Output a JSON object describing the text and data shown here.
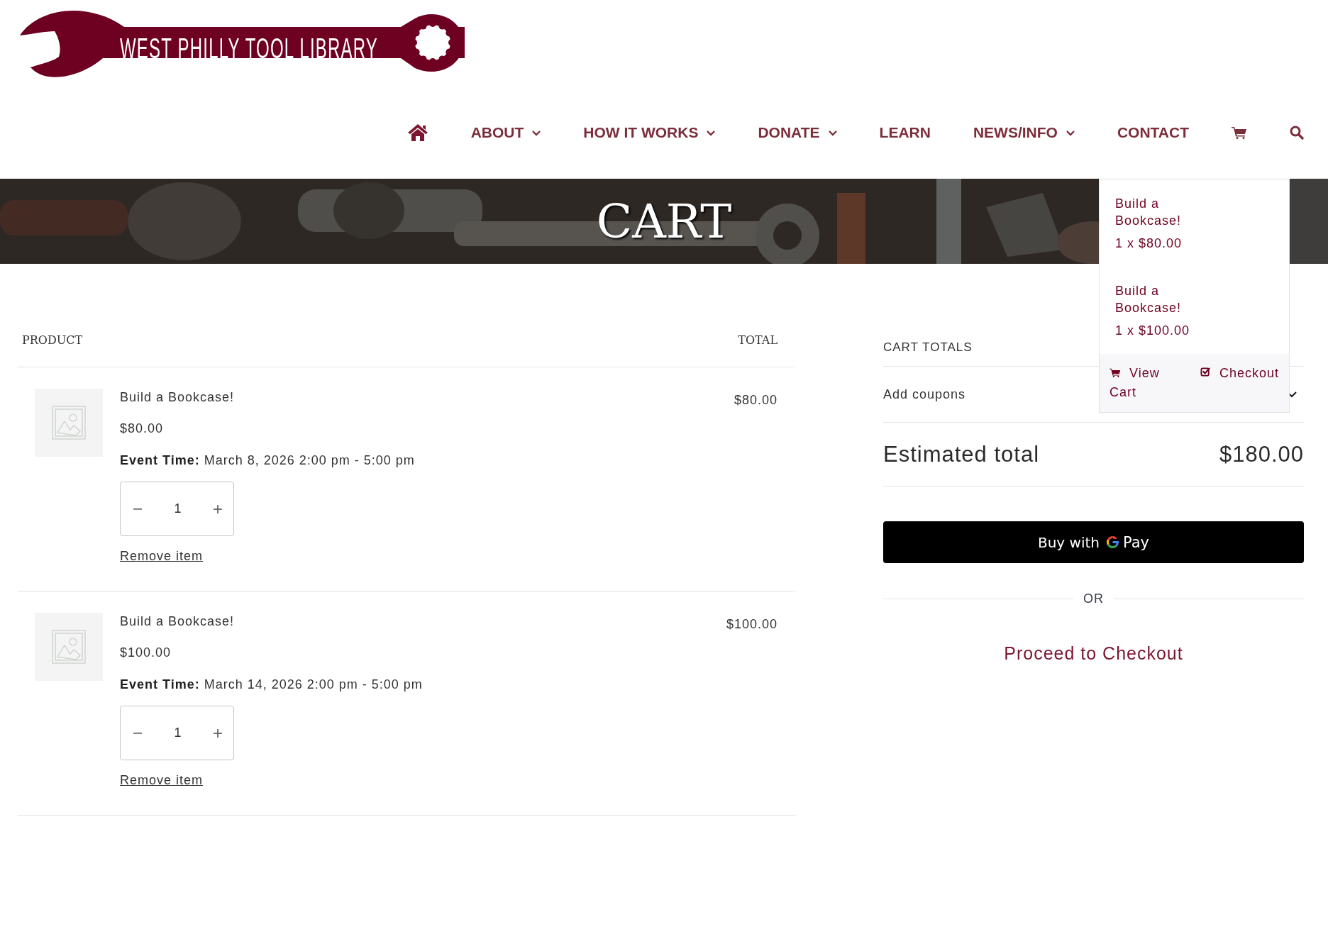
{
  "logo": {
    "text": "WEST PHILLY TOOL LIBRARY"
  },
  "nav": [
    {
      "label": "ABOUT",
      "has_menu": true
    },
    {
      "label": "HOW IT WORKS",
      "has_menu": true
    },
    {
      "label": "DONATE",
      "has_menu": true
    },
    {
      "label": "LEARN",
      "has_menu": false
    },
    {
      "label": "NEWS/INFO",
      "has_menu": true
    },
    {
      "label": "CONTACT",
      "has_menu": false
    }
  ],
  "banner": {
    "title": "CART"
  },
  "mini_cart": {
    "items": [
      {
        "name": "Build a Bookcase!",
        "line": "1 x $80.00"
      },
      {
        "name": "Build a Bookcase!",
        "line": "1 x $100.00"
      }
    ],
    "view_cart": "View Cart",
    "checkout": "Checkout"
  },
  "cart_table": {
    "columns": [
      "PRODUCT",
      "TOTAL"
    ],
    "rows": [
      {
        "name": "Build a Bookcase!",
        "price": "$80.00",
        "event": "**Event Time:** March 8, 2026 2:00 pm - 5:00 pm",
        "quantity": "1",
        "remove": "Remove item",
        "total": "$80.00"
      },
      {
        "name": "Build a Bookcase!",
        "price": "$100.00",
        "event": "**Event Time:** March 14, 2026 2:00 pm - 5:00 pm",
        "quantity": "1",
        "remove": "Remove item",
        "total": "$100.00"
      }
    ]
  },
  "totals": {
    "title": "CART TOTALS",
    "coupons": "Add coupons",
    "estimated_label": "Estimated total",
    "estimated_value": "$180.00",
    "gpay_text": "Buy with",
    "gpay_brand": "Pay",
    "or": "OR",
    "checkout": "Proceed to Checkout"
  }
}
